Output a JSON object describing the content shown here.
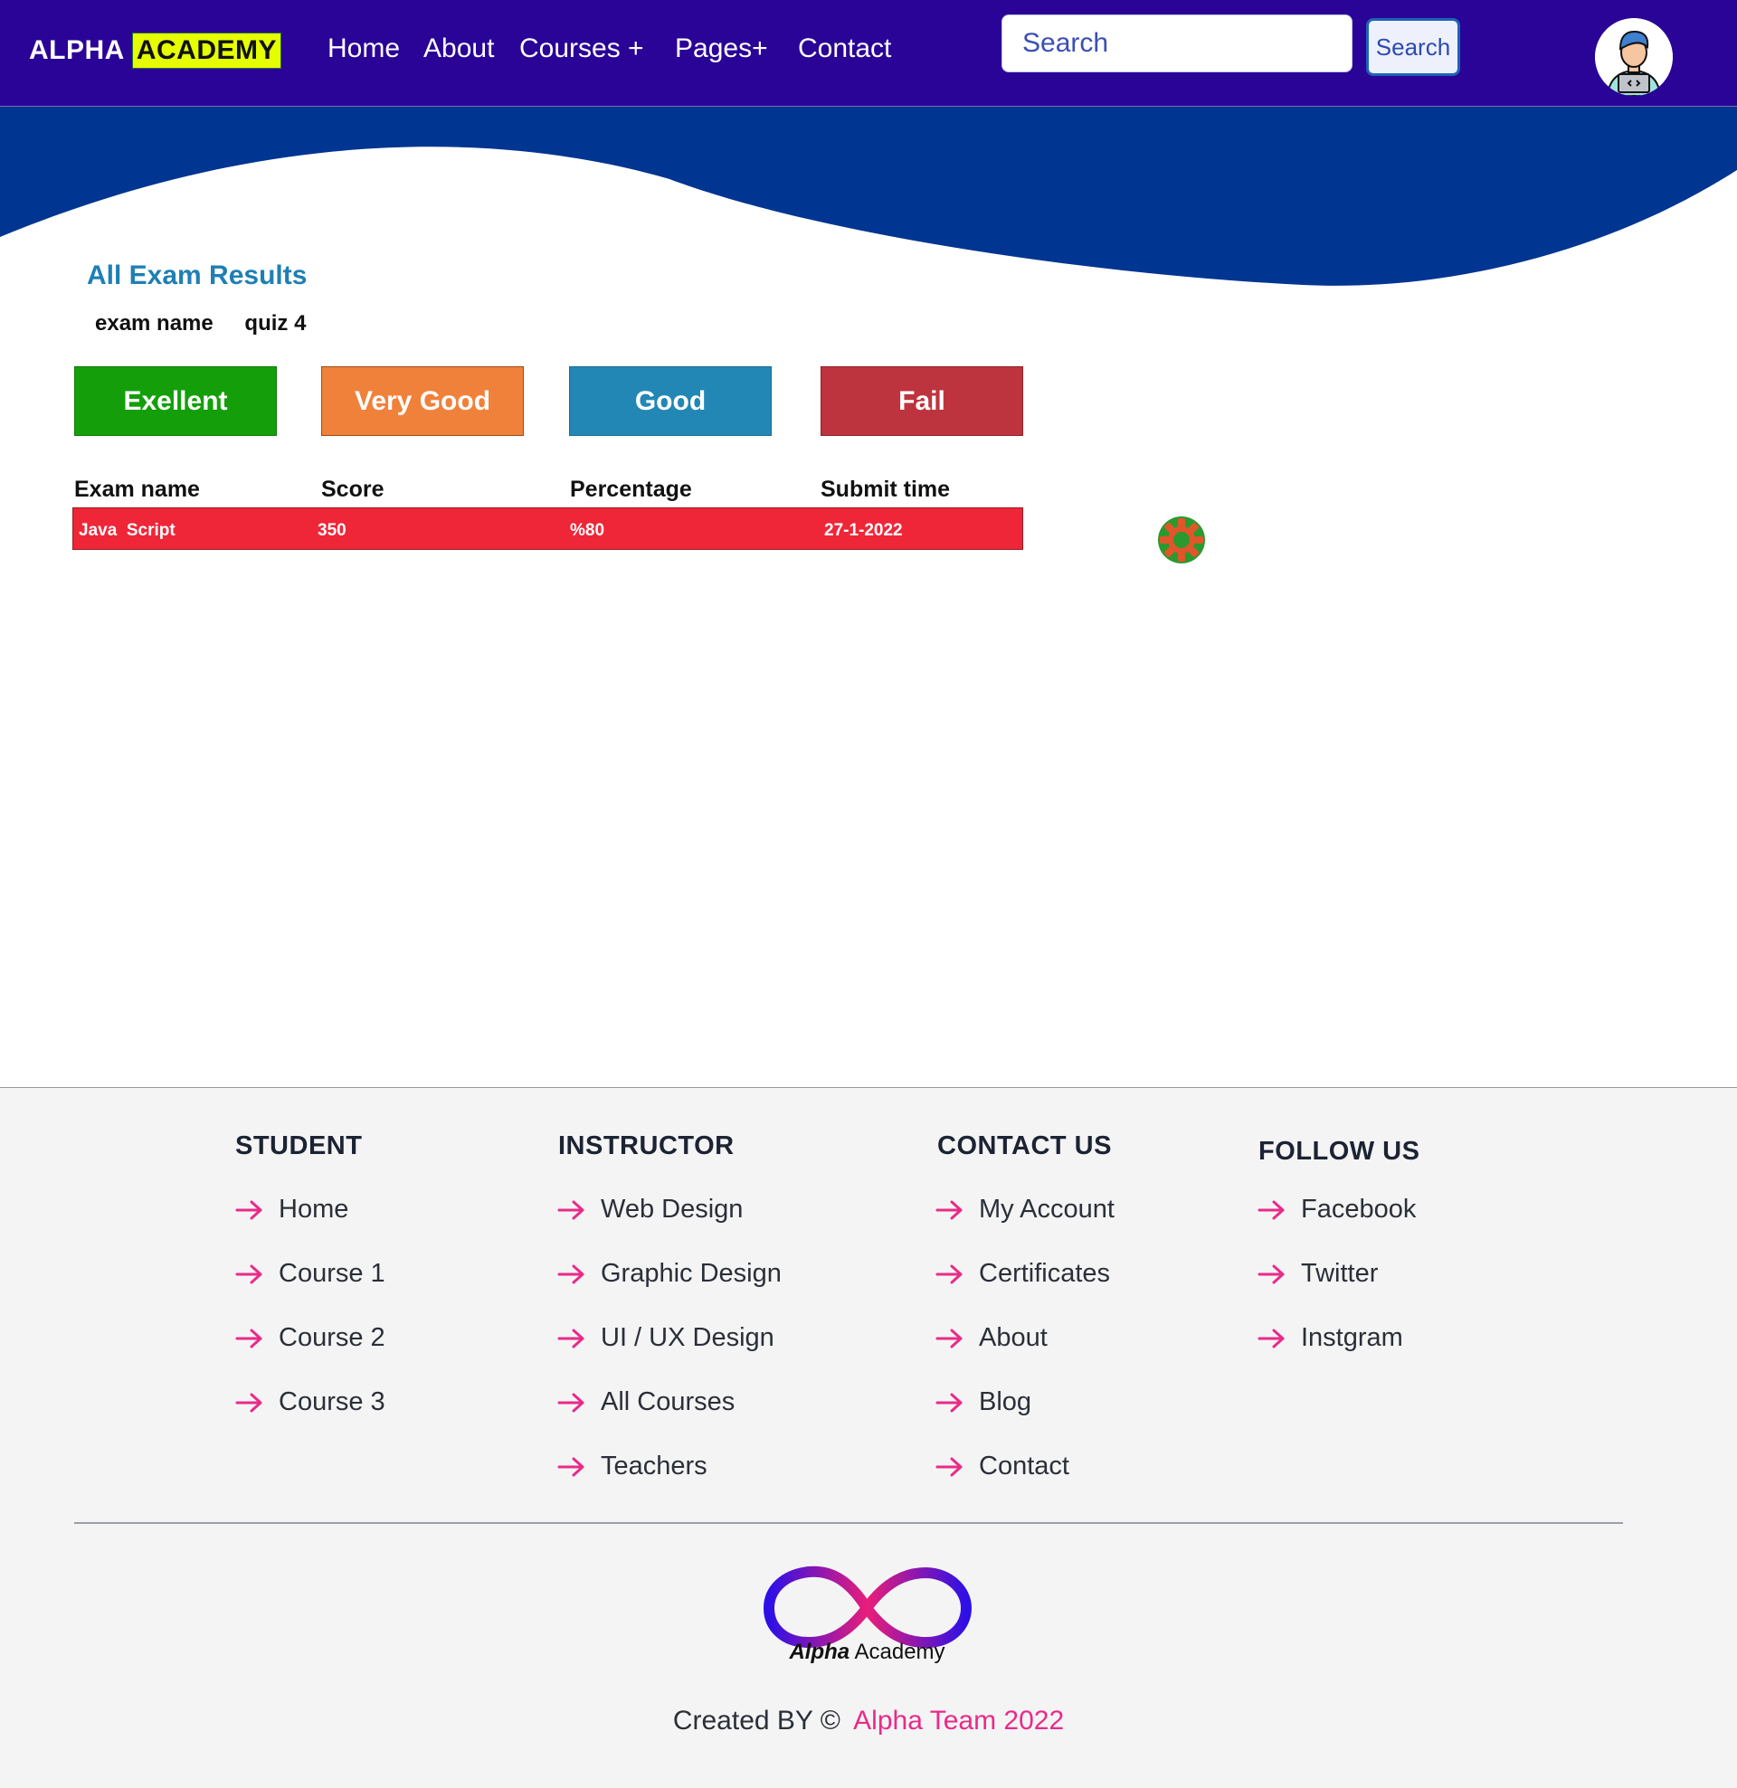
{
  "navbar": {
    "brand": {
      "part1": "ALPHA",
      "part2": "ACADEMY"
    },
    "links": [
      "Home",
      "About",
      "Courses +",
      "Pages+",
      "Contact"
    ],
    "search": {
      "placeholder": "Search",
      "button_label": "Search"
    },
    "avatar_icon": "developer-avatar-icon"
  },
  "results": {
    "title": "All Exam Results",
    "exam_name_label": "exam name",
    "exam_name_value": "quiz 4",
    "grade_buttons": [
      {
        "label": "Exellent",
        "color": "#149f0a"
      },
      {
        "label": "Very Good",
        "color": "#f0813b"
      },
      {
        "label": "Good",
        "color": "#2287b4"
      },
      {
        "label": "Fail",
        "color": "#be343e"
      }
    ],
    "table": {
      "headers": [
        "Exam name",
        "Score",
        "Percentage",
        "Submit time"
      ],
      "rows": [
        {
          "exam_name": "Java  Script",
          "score": "350",
          "percentage": "%80",
          "submit_time": "27-1-2022",
          "color": "#ef2638"
        }
      ]
    },
    "settings_icon": "gear-icon"
  },
  "footer": {
    "columns": [
      {
        "title": "STUDENT",
        "links": [
          "Home",
          "Course 1",
          "Course 2",
          "Course 3"
        ]
      },
      {
        "title": "INSTRUCTOR",
        "links": [
          "Web Design",
          "Graphic Design",
          "UI / UX Design",
          "All Courses",
          "Teachers"
        ]
      },
      {
        "title": "CONTACT US",
        "links": [
          "My Account",
          "Certificates",
          "About",
          "Blog",
          "Contact"
        ]
      },
      {
        "title": "FOLLOW US",
        "links": [
          "Facebook",
          "Twitter",
          "Instgram"
        ]
      }
    ],
    "link_icon": "arrow-right-icon",
    "logo": {
      "name_bold": "Alpha",
      "name_rest": "Academy",
      "icon": "infinity-logo-icon"
    },
    "credit": {
      "prefix": "Created BY ©",
      "team": "Alpha Team 2022"
    }
  },
  "colors": {
    "navbar": "#2a0496",
    "wave": "#003591",
    "accent_pink": "#ea2a88",
    "title_blue": "#1f7fb5",
    "brand_highlight": "#e6ff00"
  }
}
